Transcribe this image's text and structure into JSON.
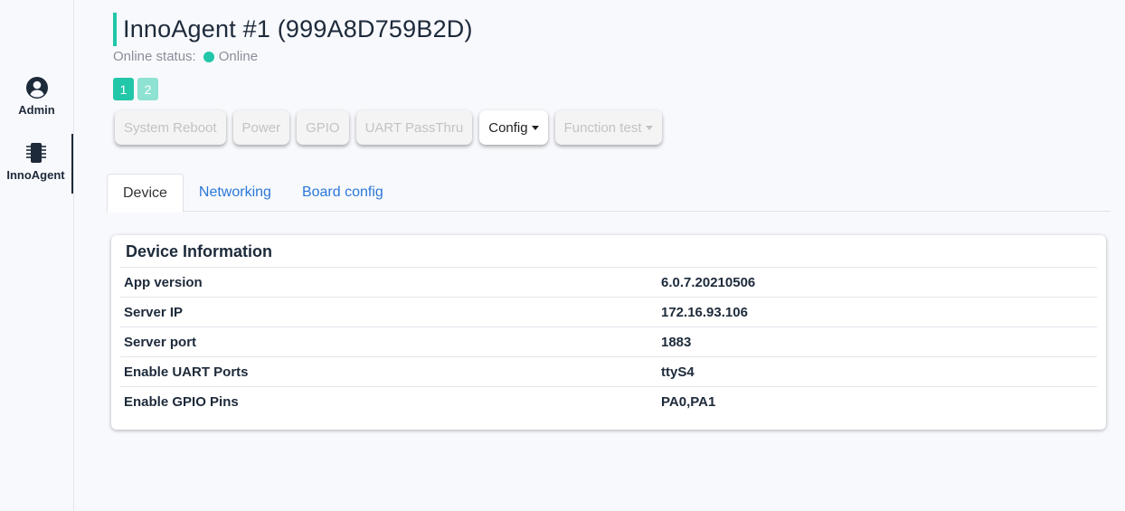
{
  "sidebar": {
    "items": [
      {
        "label": "Admin",
        "icon": "user-circle-icon"
      },
      {
        "label": "InnoAgent",
        "icon": "chip-icon"
      }
    ]
  },
  "header": {
    "title": "InnoAgent #1 (999A8D759B2D)",
    "status_label": "Online status:",
    "status_value": "Online"
  },
  "pagination": [
    "1",
    "2"
  ],
  "toolbar": {
    "system_reboot": "System Reboot",
    "power": "Power",
    "gpio": "GPIO",
    "uart": "UART PassThru",
    "config": "Config",
    "function_test": "Function test"
  },
  "tabs": [
    "Device",
    "Networking",
    "Board config"
  ],
  "device_info": {
    "title": "Device Information",
    "rows": [
      {
        "key": "App version",
        "value": "6.0.7.20210506"
      },
      {
        "key": "Server IP",
        "value": "172.16.93.106"
      },
      {
        "key": "Server port",
        "value": "1883"
      },
      {
        "key": "Enable UART Ports",
        "value": "ttyS4"
      },
      {
        "key": "Enable GPIO Pins",
        "value": "PA0,PA1"
      }
    ]
  },
  "colors": {
    "accent": "#21c7a8",
    "link": "#2b78d8",
    "text": "#1d2a3a"
  }
}
